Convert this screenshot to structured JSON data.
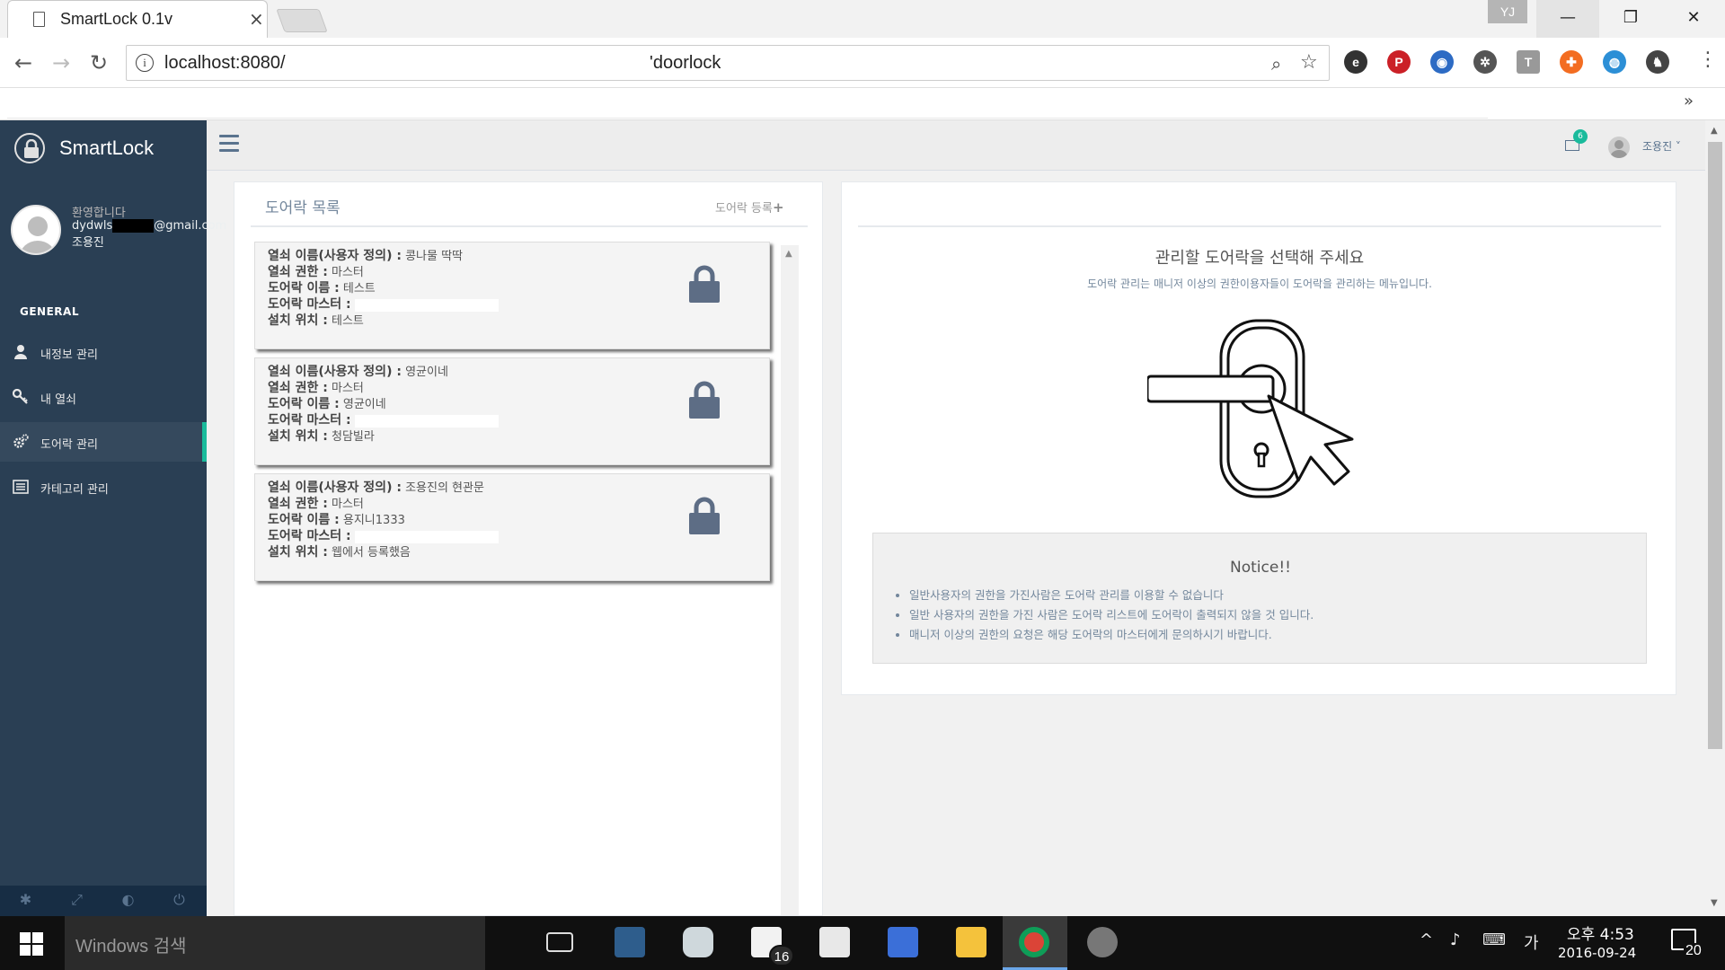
{
  "browser": {
    "tab_title": "SmartLock 0.1v",
    "tab_close": "×",
    "profile_badge": "YJ",
    "win_min": "—",
    "win_max": "❐",
    "win_close": "✕",
    "url_host": "localhost:8080/",
    "url_path": "'doorlock",
    "bookmarks_more": "»"
  },
  "sidebar": {
    "brand": "SmartLock",
    "welcome": "환영합니다",
    "email_prefix": "dydwls",
    "email_suffix": "@gmail.com",
    "user_name": "조용진",
    "section": "GENERAL",
    "items": [
      {
        "label": "내정보 관리",
        "icon": "user-icon"
      },
      {
        "label": "내 열쇠",
        "icon": "key-icon"
      },
      {
        "label": "도어락 관리",
        "icon": "cogs-icon",
        "active": true
      },
      {
        "label": "카테고리 관리",
        "icon": "list-icon"
      }
    ]
  },
  "topnav": {
    "mail_count": "6",
    "user_label": "조용진 ˅"
  },
  "doorlock_list": {
    "title": "도어락 목록",
    "add_label": "도어락 등록",
    "add_plus": "+",
    "field_labels": {
      "key_name": "열쇠 이름(사용자 정의) :",
      "key_role": "열쇠 권한 :",
      "lock_name": "도어락 이름 :",
      "lock_master": "도어락 마스터 :",
      "location": "설치 위치 :"
    },
    "cards": [
      {
        "key_name": "콩나물 딱딱",
        "key_role": "마스터",
        "lock_name": "테스트",
        "location": "테스트"
      },
      {
        "key_name": "영균이네",
        "key_role": "마스터",
        "lock_name": "영균이네",
        "location": "청담빌라"
      },
      {
        "key_name": "조용진의 현관문",
        "key_role": "마스터",
        "lock_name": "용지니1333",
        "location": "웹에서 등록했음"
      }
    ]
  },
  "detail": {
    "heading": "관리할 도어락을 선택해 주세요",
    "subheading": "도어락 관리는 매니저 이상의 권한이용자들이 도어락을 관리하는 메뉴입니다.",
    "notice_title": "Notice!!",
    "notice_items": [
      "일반사용자의 권한을 가진사람은 도어락 관리를 이용할 수 없습니다",
      "일반 사용자의 권한을 가진 사람은 도어락 리스트에 도어락이 출력되지 않을 것 입니다.",
      "매니저 이상의 권한의 요청은 해당 도어락의 마스터에게 문의하시기 바랍니다."
    ]
  },
  "taskbar": {
    "search_placeholder": "Windows 검색",
    "mail_badge": "16",
    "ime": "가",
    "time": "오후 4:53",
    "date": "2016-09-24",
    "notifications": "20"
  }
}
